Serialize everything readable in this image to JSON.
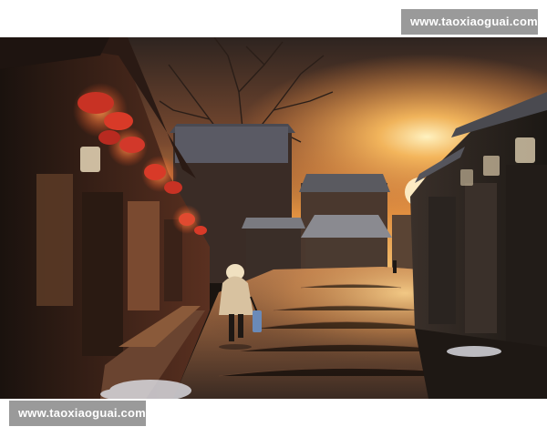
{
  "watermarks": {
    "top": "www.taoxiaoguai.com",
    "bottom": "www.taoxiaoguai.com"
  },
  "photo": {
    "scene": "old-street-sunset",
    "colors": {
      "sky_top": "#3a2a24",
      "sky_glow": "#f0a040",
      "sun": "#ffe9a8",
      "wall_dark": "#2a1e18",
      "wall_brick": "#6a3a26",
      "lantern": "#d2382a",
      "lantern_glow": "#ff8a3a",
      "street_light": "#e8b070",
      "street_dark": "#3a2c24",
      "coat": "#d8c2a0"
    }
  }
}
